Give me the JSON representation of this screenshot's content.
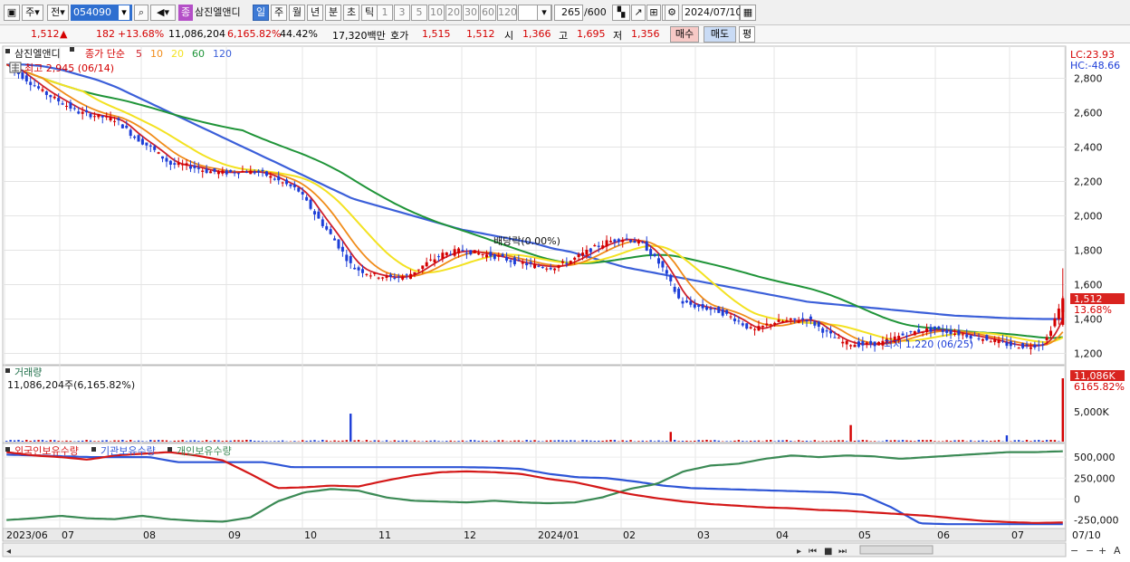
{
  "toolbar": {
    "market": "주",
    "period_sel": "전",
    "code": "054090",
    "stock_badge": "종",
    "stock_name": "삼진엘앤디",
    "period_tabs": [
      "일",
      "주",
      "월",
      "년",
      "분",
      "초",
      "틱"
    ],
    "active_period": "일",
    "num_tabs": [
      "1",
      "3",
      "5",
      "10",
      "20",
      "30",
      "60",
      "120"
    ],
    "count": "265",
    "count_total": "/600",
    "date": "2024/07/10"
  },
  "quote": {
    "price": "1,512",
    "arrow": "▲",
    "change": "182",
    "change_pct": "+13.68%",
    "volume": "11,086,204",
    "vol_ratio": "6,165.82%",
    "turnover": "44.42%",
    "amount": "17,320백만",
    "hoga_label": "호가",
    "ask": "1,515",
    "bid": "1,512",
    "open_label": "시",
    "open": "1,366",
    "high_label": "고",
    "high": "1,695",
    "low_label": "저",
    "low": "1,356",
    "buy": "매수",
    "sell": "매도",
    "eval": "평"
  },
  "price_panel": {
    "name": "삼진엘앤디",
    "ma_label": "종가 단순",
    "ma": [
      {
        "period": "5",
        "color": "#d0202a"
      },
      {
        "period": "10",
        "color": "#f08c1a"
      },
      {
        "period": "20",
        "color": "#f3e221"
      },
      {
        "period": "60",
        "color": "#1f9438"
      },
      {
        "period": "120",
        "color": "#3b5fd9"
      }
    ],
    "high_note": "최고 2,945 (06/14)",
    "low_note": "최저 1,220 (06/25)",
    "dividend_note": "배당락(0.00%)",
    "lc": "LC:23.93",
    "hc": "HC:-48.66",
    "last_price": "1,512",
    "last_pct": "13.68%",
    "y_ticks": [
      "2,800",
      "2,600",
      "2,400",
      "2,200",
      "2,000",
      "1,800",
      "1,600",
      "1,400",
      "1,200"
    ]
  },
  "volume_panel": {
    "title": "거래량",
    "summary": "11,086,204주(6,165.82%)",
    "last_label": "11,086K",
    "last_pct": "6165.82%",
    "tick": "5,000K"
  },
  "holding_panel": {
    "legend": [
      {
        "name": "외국인보유수량",
        "color": "#d41818"
      },
      {
        "name": "기관보유수량",
        "color": "#2e55d6"
      },
      {
        "name": "개인보유수량",
        "color": "#3b8a55"
      }
    ],
    "y_ticks": [
      "500,000",
      "250,000",
      "0",
      "-250,000"
    ]
  },
  "x_axis": [
    "2023/06",
    "07",
    "08",
    "09",
    "10",
    "11",
    "12",
    "2024/01",
    "02",
    "03",
    "04",
    "05",
    "06",
    "07",
    "07/10"
  ],
  "colors": {
    "up": "#d40000",
    "down": "#1d3ed8",
    "grid": "#e4e4e4",
    "badge": "#d9231f"
  },
  "chart_data": {
    "type": "line",
    "x_range": [
      "2023/06",
      "2024/07/10"
    ],
    "price": {
      "ylim": [
        1150,
        2950
      ],
      "close_approx": [
        2880,
        2800,
        2720,
        2660,
        2600,
        2580,
        2560,
        2460,
        2390,
        2300,
        2290,
        2260,
        2250,
        2260,
        2250,
        2200,
        2150,
        2000,
        1860,
        1700,
        1660,
        1640,
        1650,
        1720,
        1780,
        1800,
        1780,
        1760,
        1730,
        1710,
        1700,
        1740,
        1800,
        1850,
        1870,
        1830,
        1700,
        1500,
        1470,
        1450,
        1400,
        1330,
        1380,
        1390,
        1400,
        1320,
        1260,
        1250,
        1260,
        1300,
        1330,
        1340,
        1320,
        1300,
        1280,
        1250,
        1240,
        1260,
        1512
      ],
      "ma120_approx": [
        2880,
        2880,
        2870,
        2850,
        2820,
        2790,
        2750,
        2700,
        2650,
        2600,
        2550,
        2500,
        2450,
        2400,
        2350,
        2300,
        2250,
        2200,
        2150,
        2100,
        2070,
        2040,
        2010,
        1980,
        1950,
        1920,
        1900,
        1880,
        1860,
        1840,
        1810,
        1790,
        1760,
        1730,
        1700,
        1680,
        1660,
        1640,
        1620,
        1600,
        1580,
        1560,
        1540,
        1520,
        1500,
        1490,
        1480,
        1470,
        1460,
        1450,
        1440,
        1430,
        1420,
        1415,
        1410,
        1405,
        1402,
        1400,
        1400
      ]
    },
    "volume": {
      "last": 11086204,
      "tick": 5000000
    },
    "holdings": {
      "ylim": [
        -330000,
        620000
      ]
    }
  }
}
